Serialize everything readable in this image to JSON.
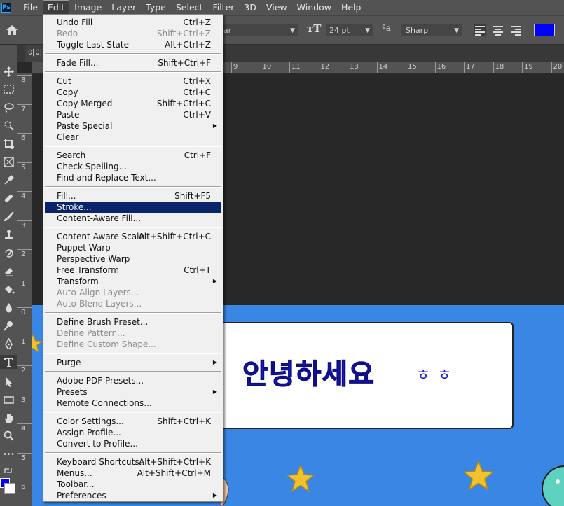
{
  "menubar": {
    "logo": "Ps",
    "items": [
      "File",
      "Edit",
      "Image",
      "Layer",
      "Type",
      "Select",
      "Filter",
      "3D",
      "View",
      "Window",
      "Help"
    ]
  },
  "options": {
    "font_style": "ar",
    "font_size": "24 pt",
    "antialias": "Sharp",
    "text_color": "#0000ff"
  },
  "document": {
    "tab_label": "아이",
    "ruler_top": [
      "9",
      "10",
      "11",
      "12",
      "13",
      "14",
      "15",
      "16",
      "17",
      "18",
      "19",
      "20"
    ],
    "ruler_left": [
      "8",
      "7",
      "6",
      "5",
      "4",
      "3",
      "2",
      "1",
      "0",
      "1",
      "2",
      "3",
      "4",
      "5",
      "6"
    ],
    "greeting": "안녕하세요",
    "emote": "ㅎㅎ"
  },
  "colors": {
    "foreground": "#0000ff",
    "background": "#ffffff",
    "canvas": "#3a86e4",
    "highlight": "#0a246a"
  },
  "edit_menu": [
    {
      "label": "Undo Fill",
      "shortcut": "Ctrl+Z"
    },
    {
      "label": "Redo",
      "shortcut": "Shift+Ctrl+Z",
      "disabled": true
    },
    {
      "label": "Toggle Last State",
      "shortcut": "Alt+Ctrl+Z"
    },
    {
      "sep": true
    },
    {
      "label": "Fade Fill...",
      "shortcut": "Shift+Ctrl+F"
    },
    {
      "sep": true
    },
    {
      "label": "Cut",
      "shortcut": "Ctrl+X"
    },
    {
      "label": "Copy",
      "shortcut": "Ctrl+C"
    },
    {
      "label": "Copy Merged",
      "shortcut": "Shift+Ctrl+C"
    },
    {
      "label": "Paste",
      "shortcut": "Ctrl+V"
    },
    {
      "label": "Paste Special",
      "submenu": true
    },
    {
      "label": "Clear"
    },
    {
      "sep": true
    },
    {
      "label": "Search",
      "shortcut": "Ctrl+F"
    },
    {
      "label": "Check Spelling..."
    },
    {
      "label": "Find and Replace Text..."
    },
    {
      "sep": true
    },
    {
      "label": "Fill...",
      "shortcut": "Shift+F5"
    },
    {
      "label": "Stroke...",
      "highlighted": true
    },
    {
      "label": "Content-Aware Fill..."
    },
    {
      "sep": true
    },
    {
      "label": "Content-Aware Scale",
      "shortcut": "Alt+Shift+Ctrl+C"
    },
    {
      "label": "Puppet Warp"
    },
    {
      "label": "Perspective Warp"
    },
    {
      "label": "Free Transform",
      "shortcut": "Ctrl+T"
    },
    {
      "label": "Transform",
      "submenu": true
    },
    {
      "label": "Auto-Align Layers...",
      "disabled": true
    },
    {
      "label": "Auto-Blend Layers...",
      "disabled": true
    },
    {
      "sep": true
    },
    {
      "label": "Define Brush Preset..."
    },
    {
      "label": "Define Pattern...",
      "disabled": true
    },
    {
      "label": "Define Custom Shape...",
      "disabled": true
    },
    {
      "sep": true
    },
    {
      "label": "Purge",
      "submenu": true
    },
    {
      "sep": true
    },
    {
      "label": "Adobe PDF Presets..."
    },
    {
      "label": "Presets",
      "submenu": true
    },
    {
      "label": "Remote Connections..."
    },
    {
      "sep": true
    },
    {
      "label": "Color Settings...",
      "shortcut": "Shift+Ctrl+K"
    },
    {
      "label": "Assign Profile..."
    },
    {
      "label": "Convert to Profile..."
    },
    {
      "sep": true
    },
    {
      "label": "Keyboard Shortcuts...",
      "shortcut": "Alt+Shift+Ctrl+K"
    },
    {
      "label": "Menus...",
      "shortcut": "Alt+Shift+Ctrl+M"
    },
    {
      "label": "Toolbar..."
    },
    {
      "label": "Preferences",
      "submenu": true
    }
  ],
  "tools": [
    "move-tool",
    "marquee-tool",
    "lasso-tool",
    "quick-select-tool",
    "crop-tool",
    "frame-tool",
    "eyedropper-tool",
    "healing-brush-tool",
    "brush-tool",
    "clone-stamp-tool",
    "history-brush-tool",
    "eraser-tool",
    "paint-bucket-tool",
    "blur-tool",
    "dodge-tool",
    "pen-tool",
    "type-tool",
    "path-select-tool",
    "rectangle-tool",
    "hand-tool",
    "zoom-tool",
    "more-tools"
  ]
}
